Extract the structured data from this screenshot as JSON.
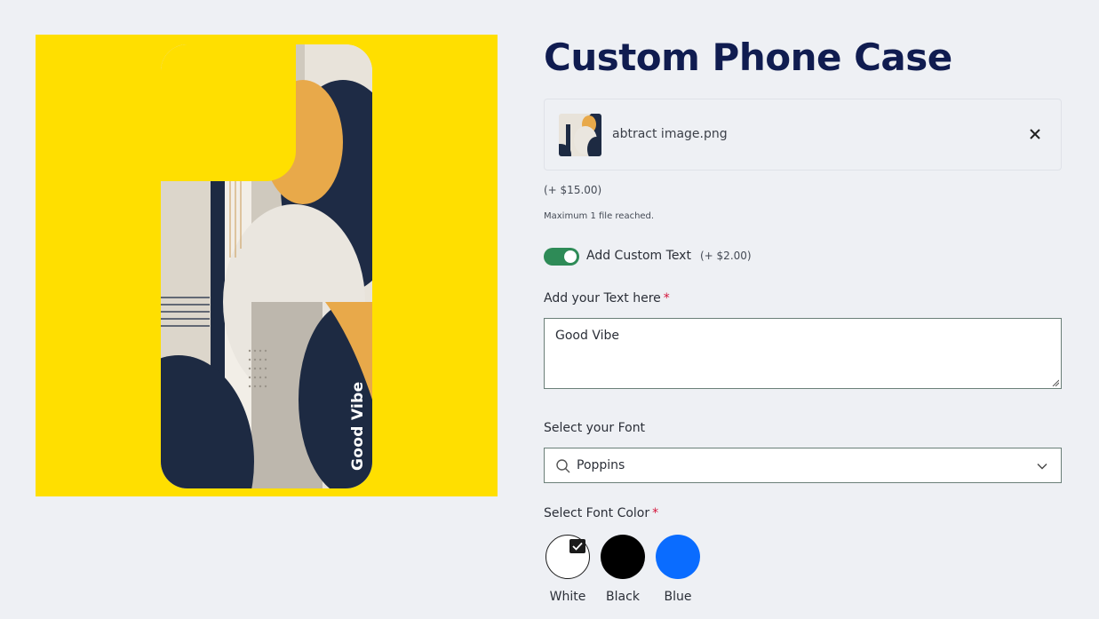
{
  "page": {
    "title": "Custom Phone Case"
  },
  "preview": {
    "case_text": "Good Vibe",
    "background_color": "#ffdf00"
  },
  "upload": {
    "file_name": "abtract image.png",
    "remove_icon": "close-icon",
    "price_note": "(+ $15.00)",
    "max_note": "Maximum 1 file reached."
  },
  "custom_text": {
    "toggle_on": true,
    "toggle_label": "Add Custom Text",
    "toggle_price": "(+ $2.00)",
    "field_label": "Add your Text here",
    "required_mark": "*",
    "value": "Good Vibe"
  },
  "font": {
    "label": "Select your Font",
    "selected": "Poppins",
    "icon": "search-icon",
    "dropdown_icon": "chevron-down-icon"
  },
  "font_color": {
    "label": "Select Font Color",
    "required_mark": "*",
    "options": [
      {
        "label": "White",
        "color": "#ffffff",
        "selected": true
      },
      {
        "label": "Black",
        "color": "#000000",
        "selected": false
      },
      {
        "label": "Blue",
        "color": "#0a6cff",
        "selected": false
      }
    ]
  },
  "colors": {
    "title": "#101c50",
    "toggle": "#2e8b57",
    "required": "#d4143a"
  }
}
